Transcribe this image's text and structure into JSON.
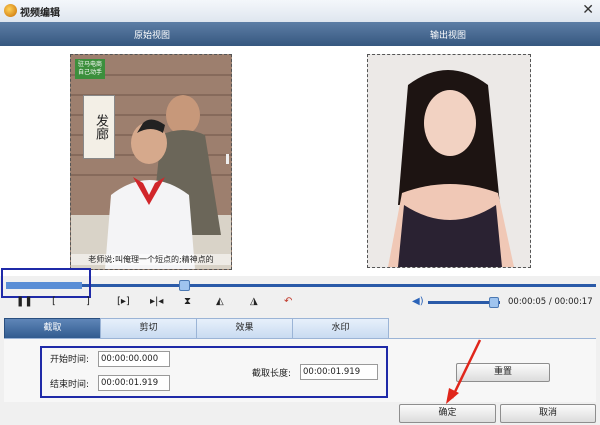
{
  "window": {
    "title": "视频编辑",
    "close_glyph": "✕"
  },
  "views": {
    "original_label": "原始视图",
    "output_label": "输出视图"
  },
  "original_video": {
    "logo_line1": "驻马电商",
    "logo_line2": "自己动手",
    "sign_text": "发廊",
    "subtitle": "老师说:叫俺理一个短点的;精神点的"
  },
  "playback": {
    "current_time": "00:00:05",
    "total_time": "00:00:17",
    "time_display": "00:00:05 / 00:00:17",
    "position_fraction": 0.3,
    "volume_fraction": 0.9,
    "icons": [
      "pause-icon",
      "mark-in-icon",
      "mark-out-icon",
      "next-segment-icon",
      "step-forward-icon",
      "flip-vertical-icon",
      "flip-left-icon",
      "flip-right-icon",
      "undo-icon",
      "volume-icon"
    ]
  },
  "tabs": [
    {
      "label": "截取",
      "active": true
    },
    {
      "label": "剪切",
      "active": false
    },
    {
      "label": "效果",
      "active": false
    },
    {
      "label": "水印",
      "active": false
    }
  ],
  "trim": {
    "start_label": "开始时间:",
    "start_value": "00:00:00.000",
    "end_label": "结束时间:",
    "end_value": "00:00:01.919",
    "length_label": "截取长度:",
    "length_value": "00:00:01.919",
    "reset_label": "重置"
  },
  "footer": {
    "ok_label": "确定",
    "cancel_label": "取消"
  },
  "colors": {
    "accent": "#2a5aa8",
    "highlight_box": "#1f2aa8",
    "annotation_arrow": "#e0261b"
  }
}
